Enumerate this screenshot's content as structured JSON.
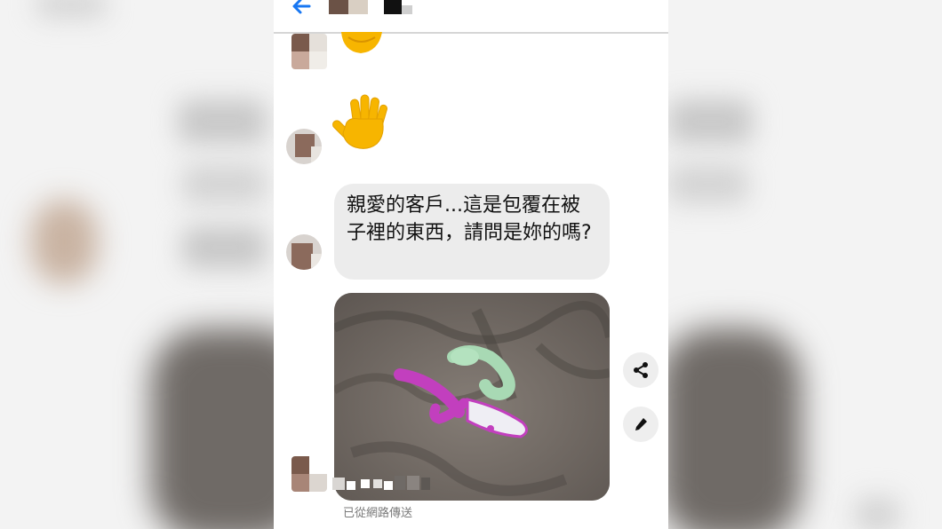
{
  "conversation": {
    "messages": [
      {
        "type": "emoji",
        "emoji": "thumbs-up (partially visible)"
      },
      {
        "type": "emoji",
        "emoji": "waving-hand"
      },
      {
        "type": "text",
        "text": "親愛的客戶...這是包覆在被子裡的東西，請問是妳的嗎?"
      },
      {
        "type": "image",
        "subject": "purple and mint-green objects on grey blanket"
      }
    ],
    "status_text": "已從網路傳送"
  },
  "icons": {
    "back": "arrow-left-icon",
    "share": "share-icon",
    "edit": "pencil-icon"
  },
  "colors": {
    "accent": "#1877f2",
    "bubble_bg": "#ececec",
    "action_bg": "#eeeeee"
  }
}
